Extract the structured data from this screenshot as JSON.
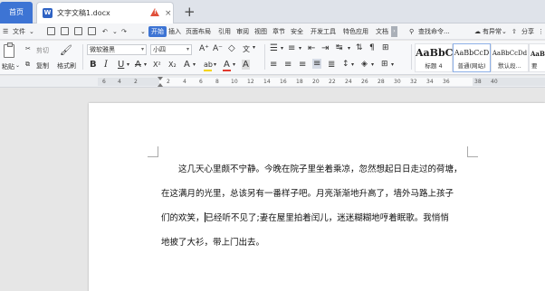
{
  "tabs": {
    "home": "首页",
    "document": "文字文稿1.docx",
    "close": "×",
    "add": "+"
  },
  "menu": {
    "file": "文件",
    "start": "开始",
    "items": [
      "插入",
      "页面布局",
      "引用",
      "审阅",
      "视图",
      "章节",
      "安全",
      "开发工具",
      "特色应用",
      "文档"
    ],
    "search": "查找命令...",
    "updates": "有异常",
    "share": "分享",
    "more": "›"
  },
  "ribbon": {
    "paste": "粘贴",
    "cut": "剪切",
    "copy": "复制",
    "format_painter": "格式刷",
    "font_name": "微软雅黑",
    "font_size": "小四",
    "grow_font": "A⁺",
    "shrink_font": "A⁻",
    "clear_format": "◇",
    "pinyin": "文",
    "bold": "B",
    "italic": "I",
    "underline": "U",
    "strike": "A",
    "superscript": "X²",
    "subscript": "X₂",
    "text_effect": "A",
    "highlight": "ab",
    "font_color": "A",
    "char_shade": "A",
    "styles": [
      {
        "sample": "AaBbC",
        "name": "标题 4"
      },
      {
        "sample": "AaBbCcD",
        "name": "普通(网站)"
      },
      {
        "sample": "AaBbCcDd",
        "name": "默认段..."
      },
      {
        "sample": "AaBb",
        "name": "要"
      }
    ],
    "colors": {
      "highlight": "#f5d400",
      "font_color": "#e23a2e",
      "accent": "#3d74d4"
    }
  },
  "ruler": {
    "numbers": [
      "6",
      "4",
      "2",
      "2",
      "4",
      "6",
      "8",
      "10",
      "12",
      "14",
      "16",
      "18",
      "20",
      "22",
      "24",
      "26",
      "28",
      "30",
      "32",
      "34",
      "36",
      "38",
      "40"
    ]
  },
  "document": {
    "paragraph_lines": [
      "　　这几天心里颇不宁静。今晚在院子里坐着乘凉，忽然想起日日走过的荷塘，",
      "在这满月的光里，总该另有一番样子吧。月亮渐渐地升高了，墙外马路上孩子",
      "们的欢笑，",
      "已经听不见了;妻在屋里拍着闰儿，迷迷糊糊地哼着眠歌。我悄悄",
      "地披了大衫，带上门出去。"
    ]
  }
}
